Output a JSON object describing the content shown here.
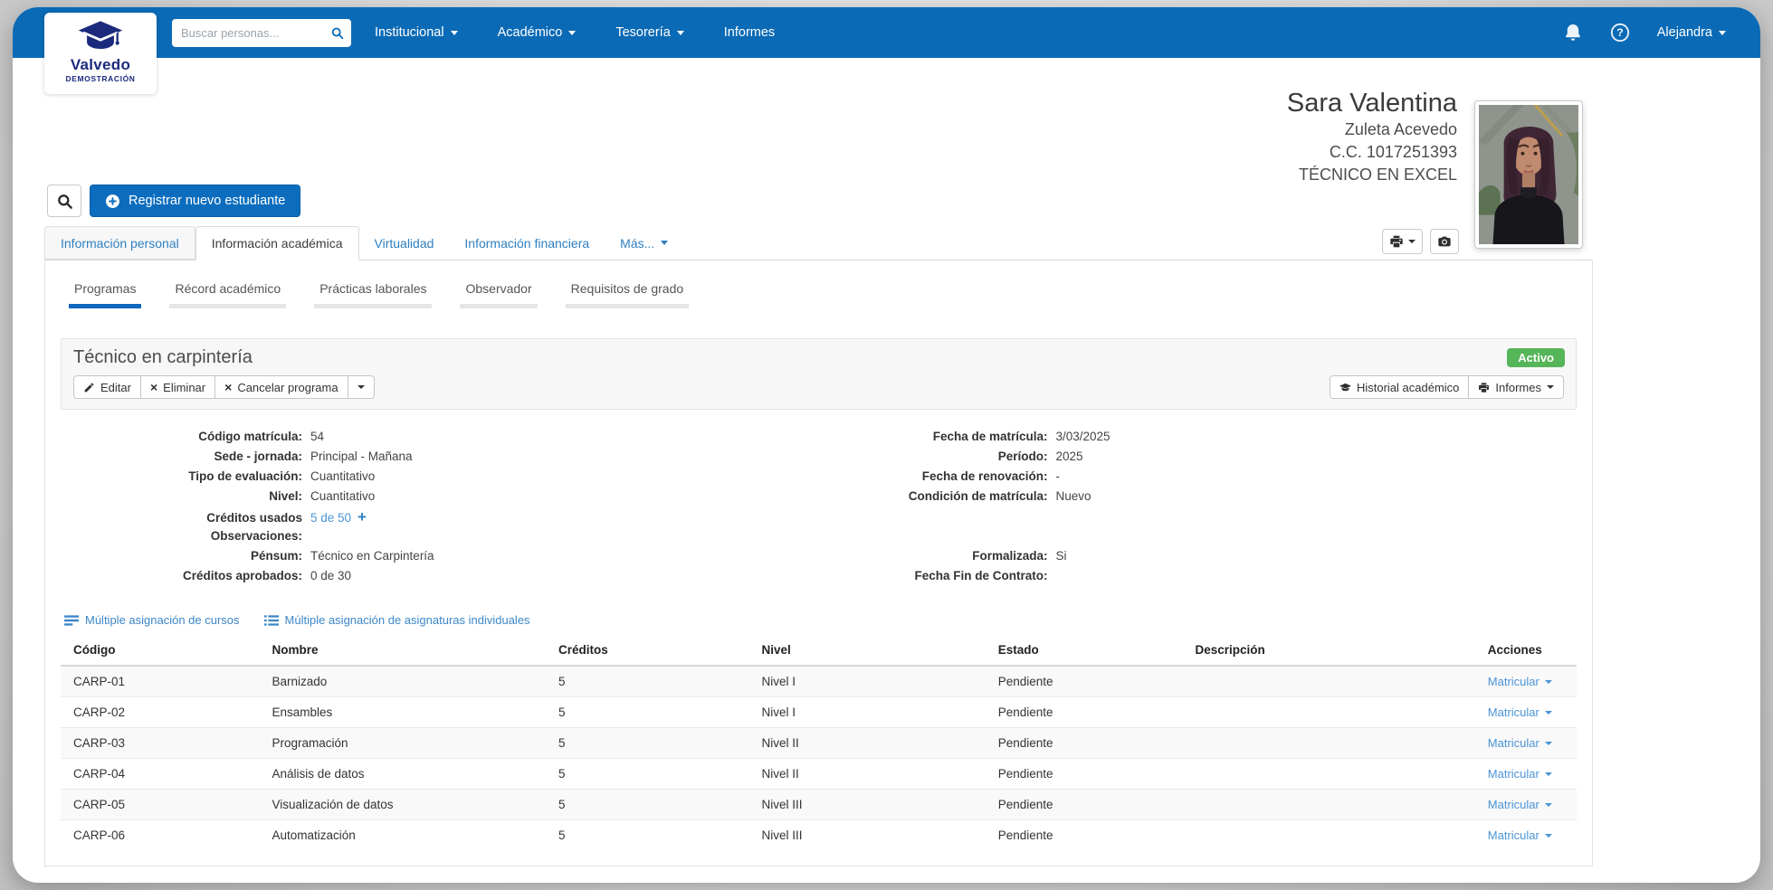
{
  "navbar": {
    "brand": {
      "name": "Valvedo",
      "subtitle": "DEMOSTRACIÓN"
    },
    "search": {
      "placeholder": "Buscar personas..."
    },
    "menu": [
      {
        "label": "Institucional",
        "caret": true
      },
      {
        "label": "Académico",
        "caret": true
      },
      {
        "label": "Tesorería",
        "caret": true
      },
      {
        "label": "Informes",
        "caret": false
      }
    ],
    "user": {
      "name": "Alejandra"
    }
  },
  "toolbar": {
    "register_label": "Registrar nuevo estudiante"
  },
  "student": {
    "first_names": "Sara Valentina",
    "last_names": "Zuleta Acevedo",
    "document": "C.C. 1017251393",
    "program_label": "TÉCNICO EN EXCEL"
  },
  "tabs": [
    {
      "label": "Información personal",
      "active": false,
      "boxed": true,
      "caret": false
    },
    {
      "label": "Información académica",
      "active": true,
      "boxed": true,
      "caret": false
    },
    {
      "label": "Virtualidad",
      "active": false,
      "boxed": false,
      "caret": false
    },
    {
      "label": "Información financiera",
      "active": false,
      "boxed": false,
      "caret": false
    },
    {
      "label": "Más...",
      "active": false,
      "boxed": false,
      "caret": true
    }
  ],
  "subtabs": [
    {
      "label": "Programas",
      "active": true
    },
    {
      "label": "Récord académico",
      "active": false
    },
    {
      "label": "Prácticas laborales",
      "active": false
    },
    {
      "label": "Observador",
      "active": false
    },
    {
      "label": "Requisitos de grado",
      "active": false
    }
  ],
  "program": {
    "title": "Técnico en carpintería",
    "status_badge": "Activo",
    "actions_left": [
      {
        "name": "edit-program-button",
        "label": "Editar",
        "icon": "pencil"
      },
      {
        "name": "delete-program-button",
        "label": "Eliminar",
        "icon": "x"
      },
      {
        "name": "cancel-program-button",
        "label": "Cancelar programa",
        "icon": "x"
      },
      {
        "name": "more-program-actions-button",
        "label": "",
        "icon": "caret"
      }
    ],
    "actions_right": [
      {
        "name": "academic-history-button",
        "label": "Historial académico",
        "icon": "cap",
        "caret": false
      },
      {
        "name": "reports-button",
        "label": "Informes",
        "icon": "printer",
        "caret": true
      }
    ],
    "fields_left": [
      {
        "label": "Código matrícula:",
        "value": "54",
        "type": "text"
      },
      {
        "label": "Sede - jornada:",
        "value": "Principal - Mañana",
        "type": "text"
      },
      {
        "label": "Tipo de evaluación:",
        "value": "Cuantitativo",
        "type": "text"
      },
      {
        "label": "Nivel:",
        "value": "Cuantitativo",
        "type": "text"
      },
      {
        "label": "Créditos usados",
        "value": "5 de 50",
        "type": "link-plus"
      },
      {
        "label": "Observaciones:",
        "value": "",
        "type": "text"
      },
      {
        "label": "Pénsum:",
        "value": "Técnico en Carpintería",
        "type": "text"
      },
      {
        "label": "Créditos aprobados:",
        "value": "0 de 30",
        "type": "text"
      }
    ],
    "fields_right": [
      {
        "label": "Fecha de matrícula:",
        "value": "3/03/2025",
        "type": "text"
      },
      {
        "label": "Período:",
        "value": "2025",
        "type": "text"
      },
      {
        "label": "Fecha de renovación:",
        "value": "-",
        "type": "text"
      },
      {
        "label": "Condición de matrícula:",
        "value": "Nuevo",
        "type": "text"
      },
      {
        "label": "",
        "value": "",
        "type": "spacer"
      },
      {
        "label": "",
        "value": "",
        "type": "spacer"
      },
      {
        "label": "Formalizada:",
        "value": "Si",
        "type": "text"
      },
      {
        "label": "Fecha Fin de Contrato:",
        "value": "",
        "type": "text"
      }
    ],
    "bulk_links": [
      {
        "label": "Múltiple asignación de cursos",
        "icon": "bars"
      },
      {
        "label": "Múltiple asignación de asignaturas individuales",
        "icon": "list"
      }
    ]
  },
  "courses_table": {
    "headers": [
      "Código",
      "Nombre",
      "Créditos",
      "Nivel",
      "Estado",
      "Descripción",
      "Acciones"
    ],
    "action_label": "Matricular",
    "rows": [
      {
        "code": "CARP-01",
        "name": "Barnizado",
        "credits": "5",
        "level": "Nivel I",
        "status": "Pendiente",
        "description": ""
      },
      {
        "code": "CARP-02",
        "name": "Ensambles",
        "credits": "5",
        "level": "Nivel I",
        "status": "Pendiente",
        "description": ""
      },
      {
        "code": "CARP-03",
        "name": "Programación",
        "credits": "5",
        "level": "Nivel II",
        "status": "Pendiente",
        "description": ""
      },
      {
        "code": "CARP-04",
        "name": "Análisis de datos",
        "credits": "5",
        "level": "Nivel II",
        "status": "Pendiente",
        "description": ""
      },
      {
        "code": "CARP-05",
        "name": "Visualización de datos",
        "credits": "5",
        "level": "Nivel III",
        "status": "Pendiente",
        "description": ""
      },
      {
        "code": "CARP-06",
        "name": "Automatización",
        "credits": "5",
        "level": "Nivel III",
        "status": "Pendiente",
        "description": ""
      }
    ]
  },
  "colors": {
    "navbar_blue": "#0b6ab5",
    "accent_link": "#2d7fc1",
    "light_link": "#4b94d6",
    "badge_green": "#55b559",
    "brand_navy": "#1b2a7d"
  }
}
